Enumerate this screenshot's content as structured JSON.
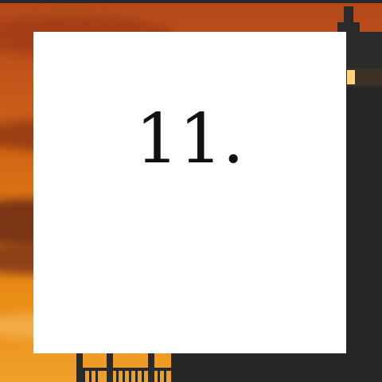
{
  "card": {
    "number_text": "11."
  },
  "background": {
    "description_icon": "lighthouse-silhouette",
    "sky_colors": [
      "#b4481a",
      "#d06416",
      "#f0a02a"
    ],
    "silhouette_color": "#262626",
    "lamp_color": "#ffd47a"
  }
}
